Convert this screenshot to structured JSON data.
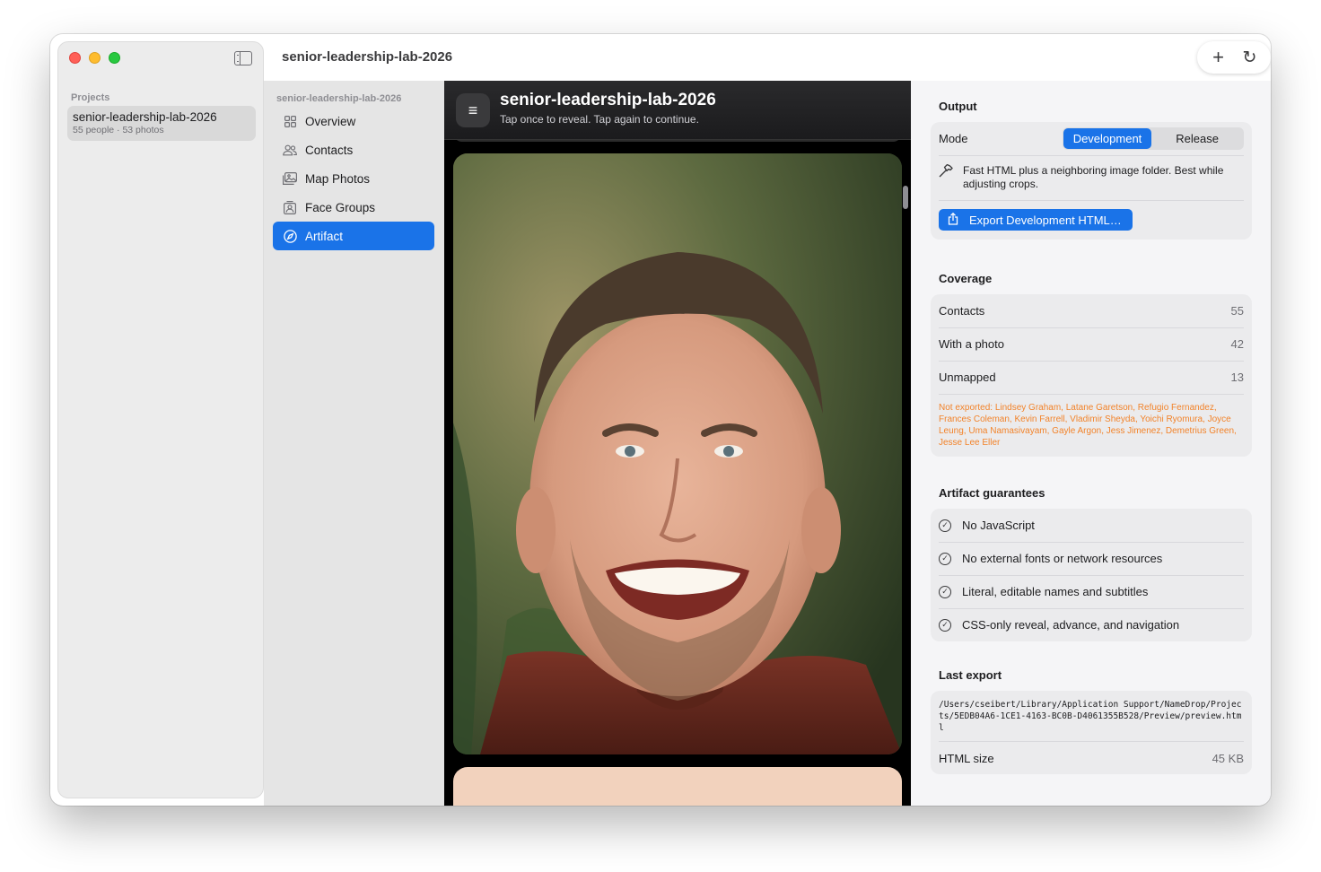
{
  "window": {
    "title": "senior-leadership-lab-2026"
  },
  "sidebar": {
    "section_label": "Projects",
    "projects": [
      {
        "name": "senior-leadership-lab-2026",
        "meta": "55 people · 53 photos"
      }
    ]
  },
  "toolbar": {
    "add_icon": "plus-icon",
    "refresh_icon": "refresh-icon"
  },
  "nav": {
    "heading": "senior-leadership-lab-2026",
    "items": [
      {
        "label": "Overview",
        "icon": "grid-icon",
        "active": false
      },
      {
        "label": "Contacts",
        "icon": "people-icon",
        "active": false
      },
      {
        "label": "Map Photos",
        "icon": "photos-icon",
        "active": false
      },
      {
        "label": "Face Groups",
        "icon": "face-group-icon",
        "active": false
      },
      {
        "label": "Artifact",
        "icon": "compass-icon",
        "active": true
      }
    ]
  },
  "preview": {
    "title": "senior-leadership-lab-2026",
    "subtitle": "Tap once to reveal. Tap again to continue."
  },
  "output": {
    "section_title": "Output",
    "mode_label": "Mode",
    "mode_options": [
      "Development",
      "Release"
    ],
    "mode_selected": "Development",
    "description": "Fast HTML plus a neighboring image folder. Best while adjusting crops.",
    "export_button": "Export Development HTML…"
  },
  "coverage": {
    "section_title": "Coverage",
    "rows": [
      {
        "label": "Contacts",
        "value": "55"
      },
      {
        "label": "With a photo",
        "value": "42"
      },
      {
        "label": "Unmapped",
        "value": "13"
      }
    ],
    "not_exported": "Not exported: Lindsey Graham, Latane Garetson, Refugio Fernandez, Frances Coleman, Kevin Farrell, Vladimir Sheyda, Yoichi Ryomura, Joyce Leung, Uma Namasivayam, Gayle Argon, Jess Jimenez, Demetrius Green, Jesse Lee Eller"
  },
  "guarantees": {
    "section_title": "Artifact guarantees",
    "items": [
      "No JavaScript",
      "No external fonts or network resources",
      "Literal, editable names and subtitles",
      "CSS-only reveal, advance, and navigation"
    ]
  },
  "last_export": {
    "section_title": "Last export",
    "path": "/Users/cseibert/Library/Application Support/NameDrop/Projects/5EDB04A6-1CE1-4163-BC0B-D4061355B528/Preview/preview.html",
    "size_label": "HTML size",
    "size_value": "45 KB"
  },
  "colors": {
    "accent": "#1a73e8",
    "warning_text": "#f2832a",
    "preview_background": "#000000"
  }
}
